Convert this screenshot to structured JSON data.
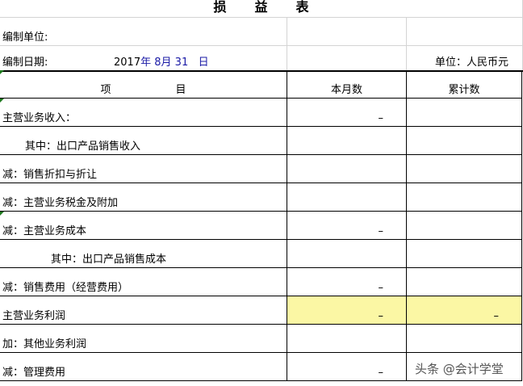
{
  "title": [
    "损",
    "益",
    "表"
  ],
  "compiler_unit_label": "编制单位:",
  "compile_date_label": "编制日期:",
  "date": {
    "year": "2017",
    "year_unit": "年",
    "month": "8月",
    "day": "31",
    "day_unit": "日"
  },
  "currency_unit": "单位：人民币元",
  "headers": {
    "item_1": "项",
    "item_2": "目",
    "month": "本月数",
    "cumulative": "累计数"
  },
  "rows": [
    {
      "label": "主营业务收入：",
      "month": "–",
      "cumulative": ""
    },
    {
      "label": "其中：出口产品销售收入",
      "month": "",
      "cumulative": ""
    },
    {
      "label": "减：销售折扣与折让",
      "month": "",
      "cumulative": ""
    },
    {
      "label": "减：主营业务税金及附加",
      "month": "",
      "cumulative": ""
    },
    {
      "label": "减：主营业务成本",
      "month": "–",
      "cumulative": ""
    },
    {
      "label": "其中：出口产品销售成本",
      "month": "",
      "cumulative": ""
    },
    {
      "label": "减：销售费用（经营费用）",
      "month": "–",
      "cumulative": ""
    },
    {
      "label": "主营业务利润",
      "month": "–",
      "cumulative": "–"
    },
    {
      "label": "加：其他业务利润",
      "month": "",
      "cumulative": ""
    },
    {
      "label": "减：管理费用",
      "month": "–",
      "cumulative": ""
    }
  ],
  "highlight_color": "#fbf7a4",
  "watermark": "头条 @会计学堂"
}
